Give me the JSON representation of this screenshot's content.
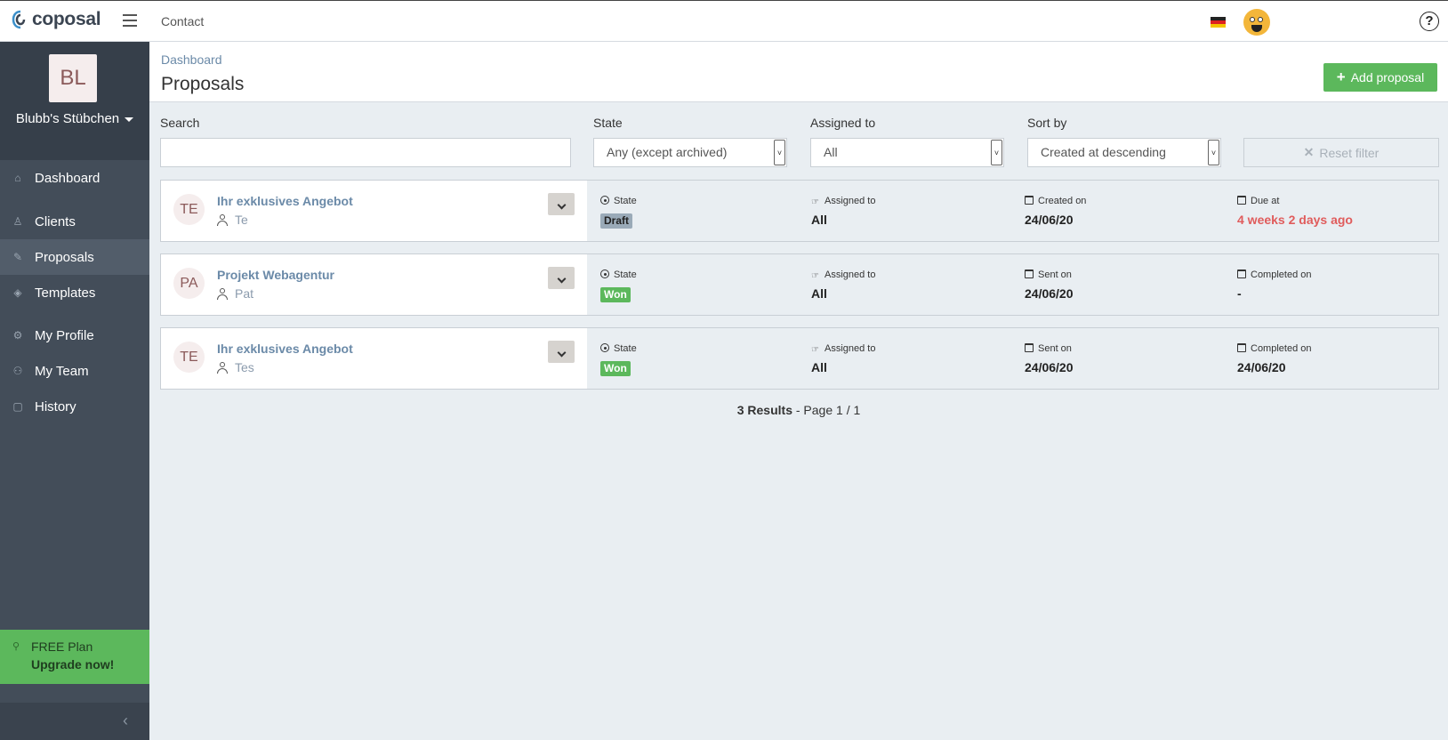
{
  "topbar": {
    "logo_text": "coposal",
    "contact_label": "Contact",
    "flag": "germany-flag",
    "help_label": "?"
  },
  "sidebar": {
    "company_initials": "BL",
    "company_name": "Blubb's Stübchen",
    "items": [
      {
        "label": "Dashboard",
        "icon": "home-icon"
      },
      {
        "label": "Clients",
        "icon": "clients-icon"
      },
      {
        "label": "Proposals",
        "icon": "proposals-icon",
        "active": true
      },
      {
        "label": "Templates",
        "icon": "templates-icon"
      },
      {
        "label": "My Profile",
        "icon": "gear-icon"
      },
      {
        "label": "My Team",
        "icon": "team-icon"
      },
      {
        "label": "History",
        "icon": "history-icon"
      }
    ],
    "plan_label": "FREE Plan",
    "upgrade_label": "Upgrade now!"
  },
  "header": {
    "breadcrumb": "Dashboard",
    "title": "Proposals",
    "add_button": "Add proposal"
  },
  "filters": {
    "search_label": "Search",
    "search_value": "",
    "state_label": "State",
    "state_value": "Any (except archived)",
    "assigned_label": "Assigned to",
    "assigned_value": "All",
    "sort_label": "Sort by",
    "sort_value": "Created at descending",
    "reset_label": "Reset filter"
  },
  "proposals": [
    {
      "initials": "TE",
      "title": "Ihr exklusives Angebot",
      "client": "Te",
      "state_label": "State",
      "state": "Draft",
      "assigned_label": "Assigned to",
      "assigned": "All",
      "date1_label": "Created on",
      "date1": "24/06/20",
      "date2_label": "Due at",
      "date2": "4 weeks 2 days ago"
    },
    {
      "initials": "PA",
      "title": "Projekt Webagentur",
      "client": "Pat",
      "state_label": "State",
      "state": "Won",
      "assigned_label": "Assigned to",
      "assigned": "All",
      "date1_label": "Sent on",
      "date1": "24/06/20",
      "date2_label": "Completed on",
      "date2": "-"
    },
    {
      "initials": "TE",
      "title": "Ihr exklusives Angebot",
      "client": "Tes",
      "state_label": "State",
      "state": "Won",
      "assigned_label": "Assigned to",
      "assigned": "All",
      "date1_label": "Sent on",
      "date1": "24/06/20",
      "date2_label": "Completed on",
      "date2": "24/06/20"
    }
  ],
  "pagination": {
    "results": "3 Results",
    "page": " - Page 1 / 1"
  },
  "colors": {
    "accent_green": "#5cb85c",
    "sidebar_bg": "#434d59",
    "link_blue": "#6b8aa8",
    "overdue_red": "#e05c5c"
  }
}
